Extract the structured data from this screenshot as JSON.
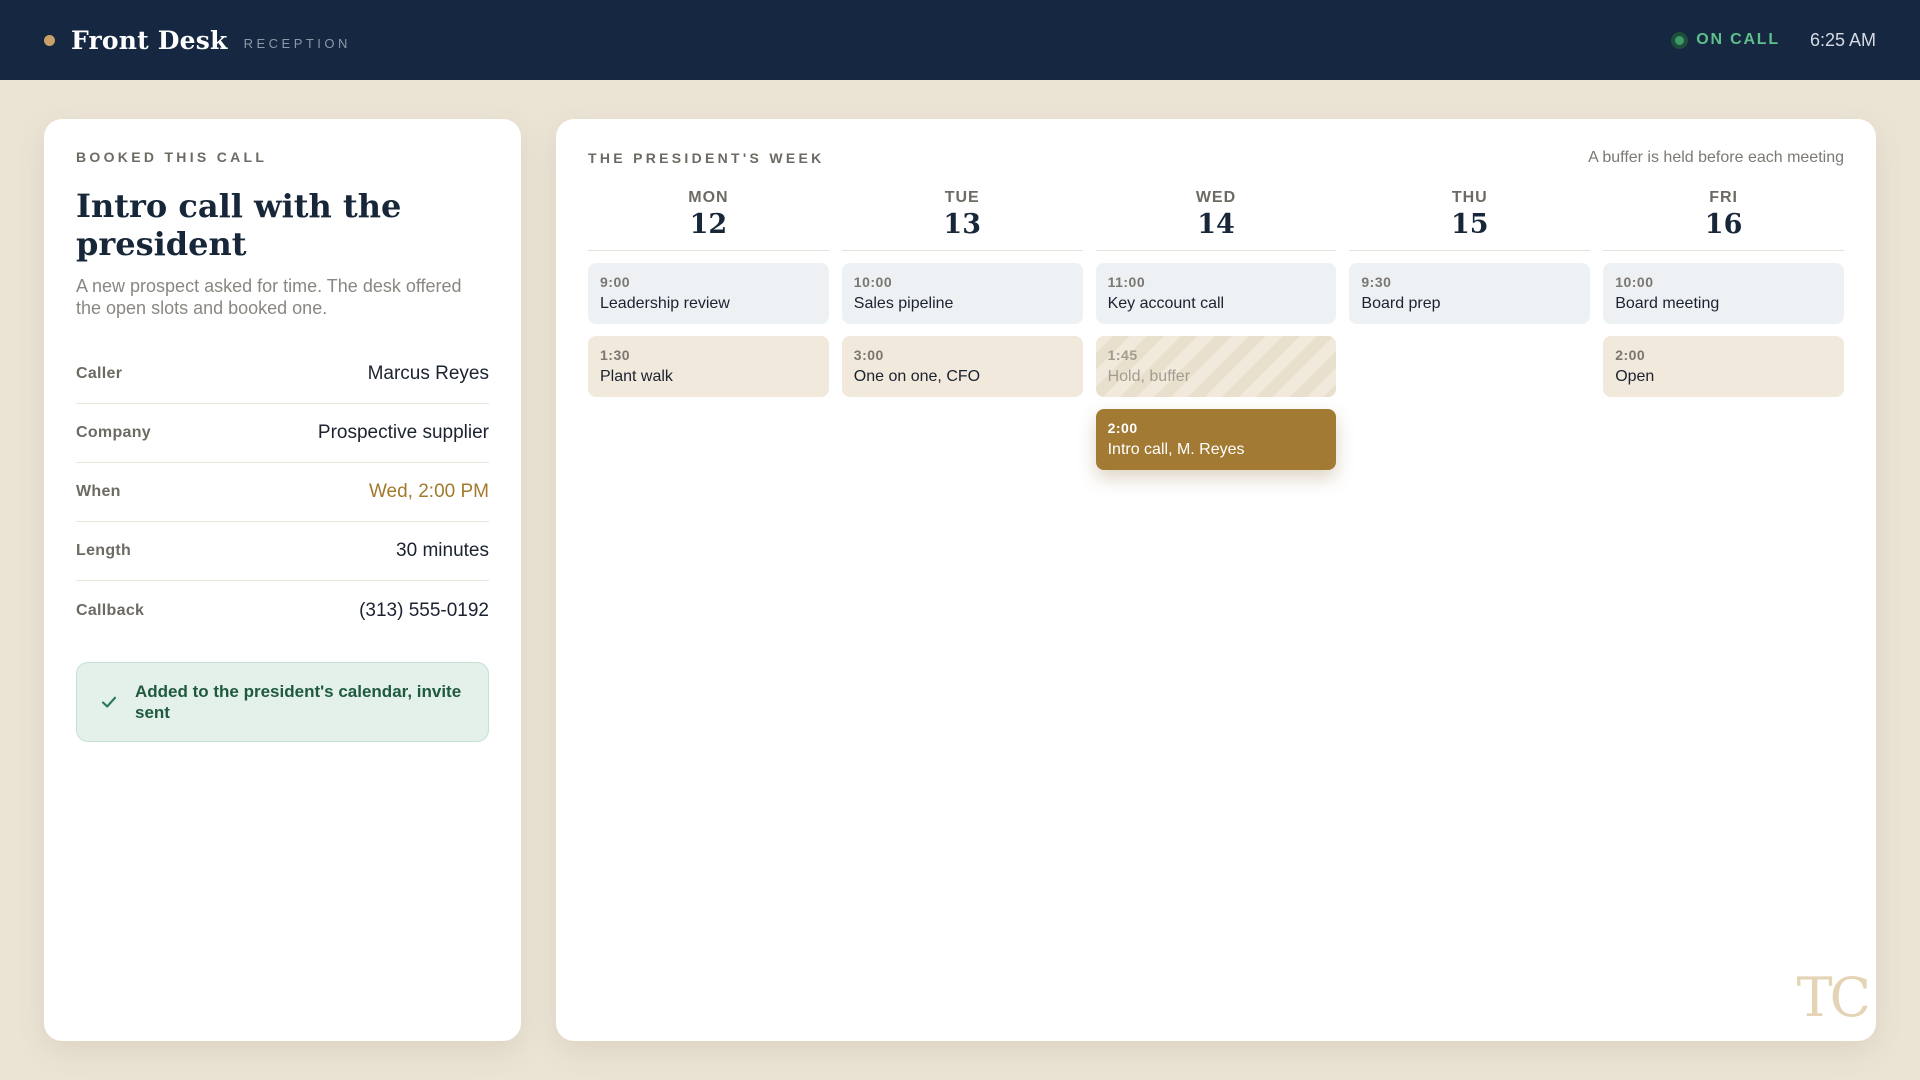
{
  "topbar": {
    "title": "Front Desk",
    "subtitle": "RECEPTION",
    "status": "ON CALL",
    "time": "6:25 AM"
  },
  "booking": {
    "eyebrow": "BOOKED THIS CALL",
    "title": "Intro call with the president",
    "description": "A new prospect asked for time. The desk offered the open slots and booked one.",
    "details": [
      {
        "label": "Caller",
        "value": "Marcus Reyes"
      },
      {
        "label": "Company",
        "value": "Prospective supplier"
      },
      {
        "label": "When",
        "value": "Wed, 2:00 PM"
      },
      {
        "label": "Length",
        "value": "30 minutes"
      },
      {
        "label": "Callback",
        "value": "(313) 555-0192"
      }
    ],
    "confirmation": "Added to the president's calendar, invite sent"
  },
  "week": {
    "eyebrow": "THE PRESIDENT'S WEEK",
    "note": "A buffer is held before each meeting",
    "days": [
      {
        "name": "MON",
        "num": "12",
        "events": [
          {
            "time": "9:00",
            "title": "Leadership review",
            "kind": "fixed"
          },
          {
            "time": "1:30",
            "title": "Plant walk",
            "kind": "open"
          }
        ]
      },
      {
        "name": "TUE",
        "num": "13",
        "events": [
          {
            "time": "10:00",
            "title": "Sales pipeline",
            "kind": "fixed"
          },
          {
            "time": "3:00",
            "title": "One on one, CFO",
            "kind": "open"
          }
        ]
      },
      {
        "name": "WED",
        "num": "14",
        "events": [
          {
            "time": "11:00",
            "title": "Key account call",
            "kind": "fixed"
          },
          {
            "time": "1:45",
            "title": "Hold, buffer",
            "kind": "buffer"
          },
          {
            "time": "2:00",
            "title": "Intro call, M. Reyes",
            "kind": "booked"
          }
        ]
      },
      {
        "name": "THU",
        "num": "15",
        "events": [
          {
            "time": "9:30",
            "title": "Board prep",
            "kind": "fixed"
          }
        ]
      },
      {
        "name": "FRI",
        "num": "16",
        "events": [
          {
            "time": "10:00",
            "title": "Board meeting",
            "kind": "fixed"
          },
          {
            "time": "2:00",
            "title": "Open",
            "kind": "open"
          }
        ]
      }
    ]
  },
  "monogram": "TC",
  "colors": {
    "navy": "#152741",
    "gold": "#a27a33",
    "on_call_green": "#5fbf8a",
    "background": "#ebe4d5"
  }
}
